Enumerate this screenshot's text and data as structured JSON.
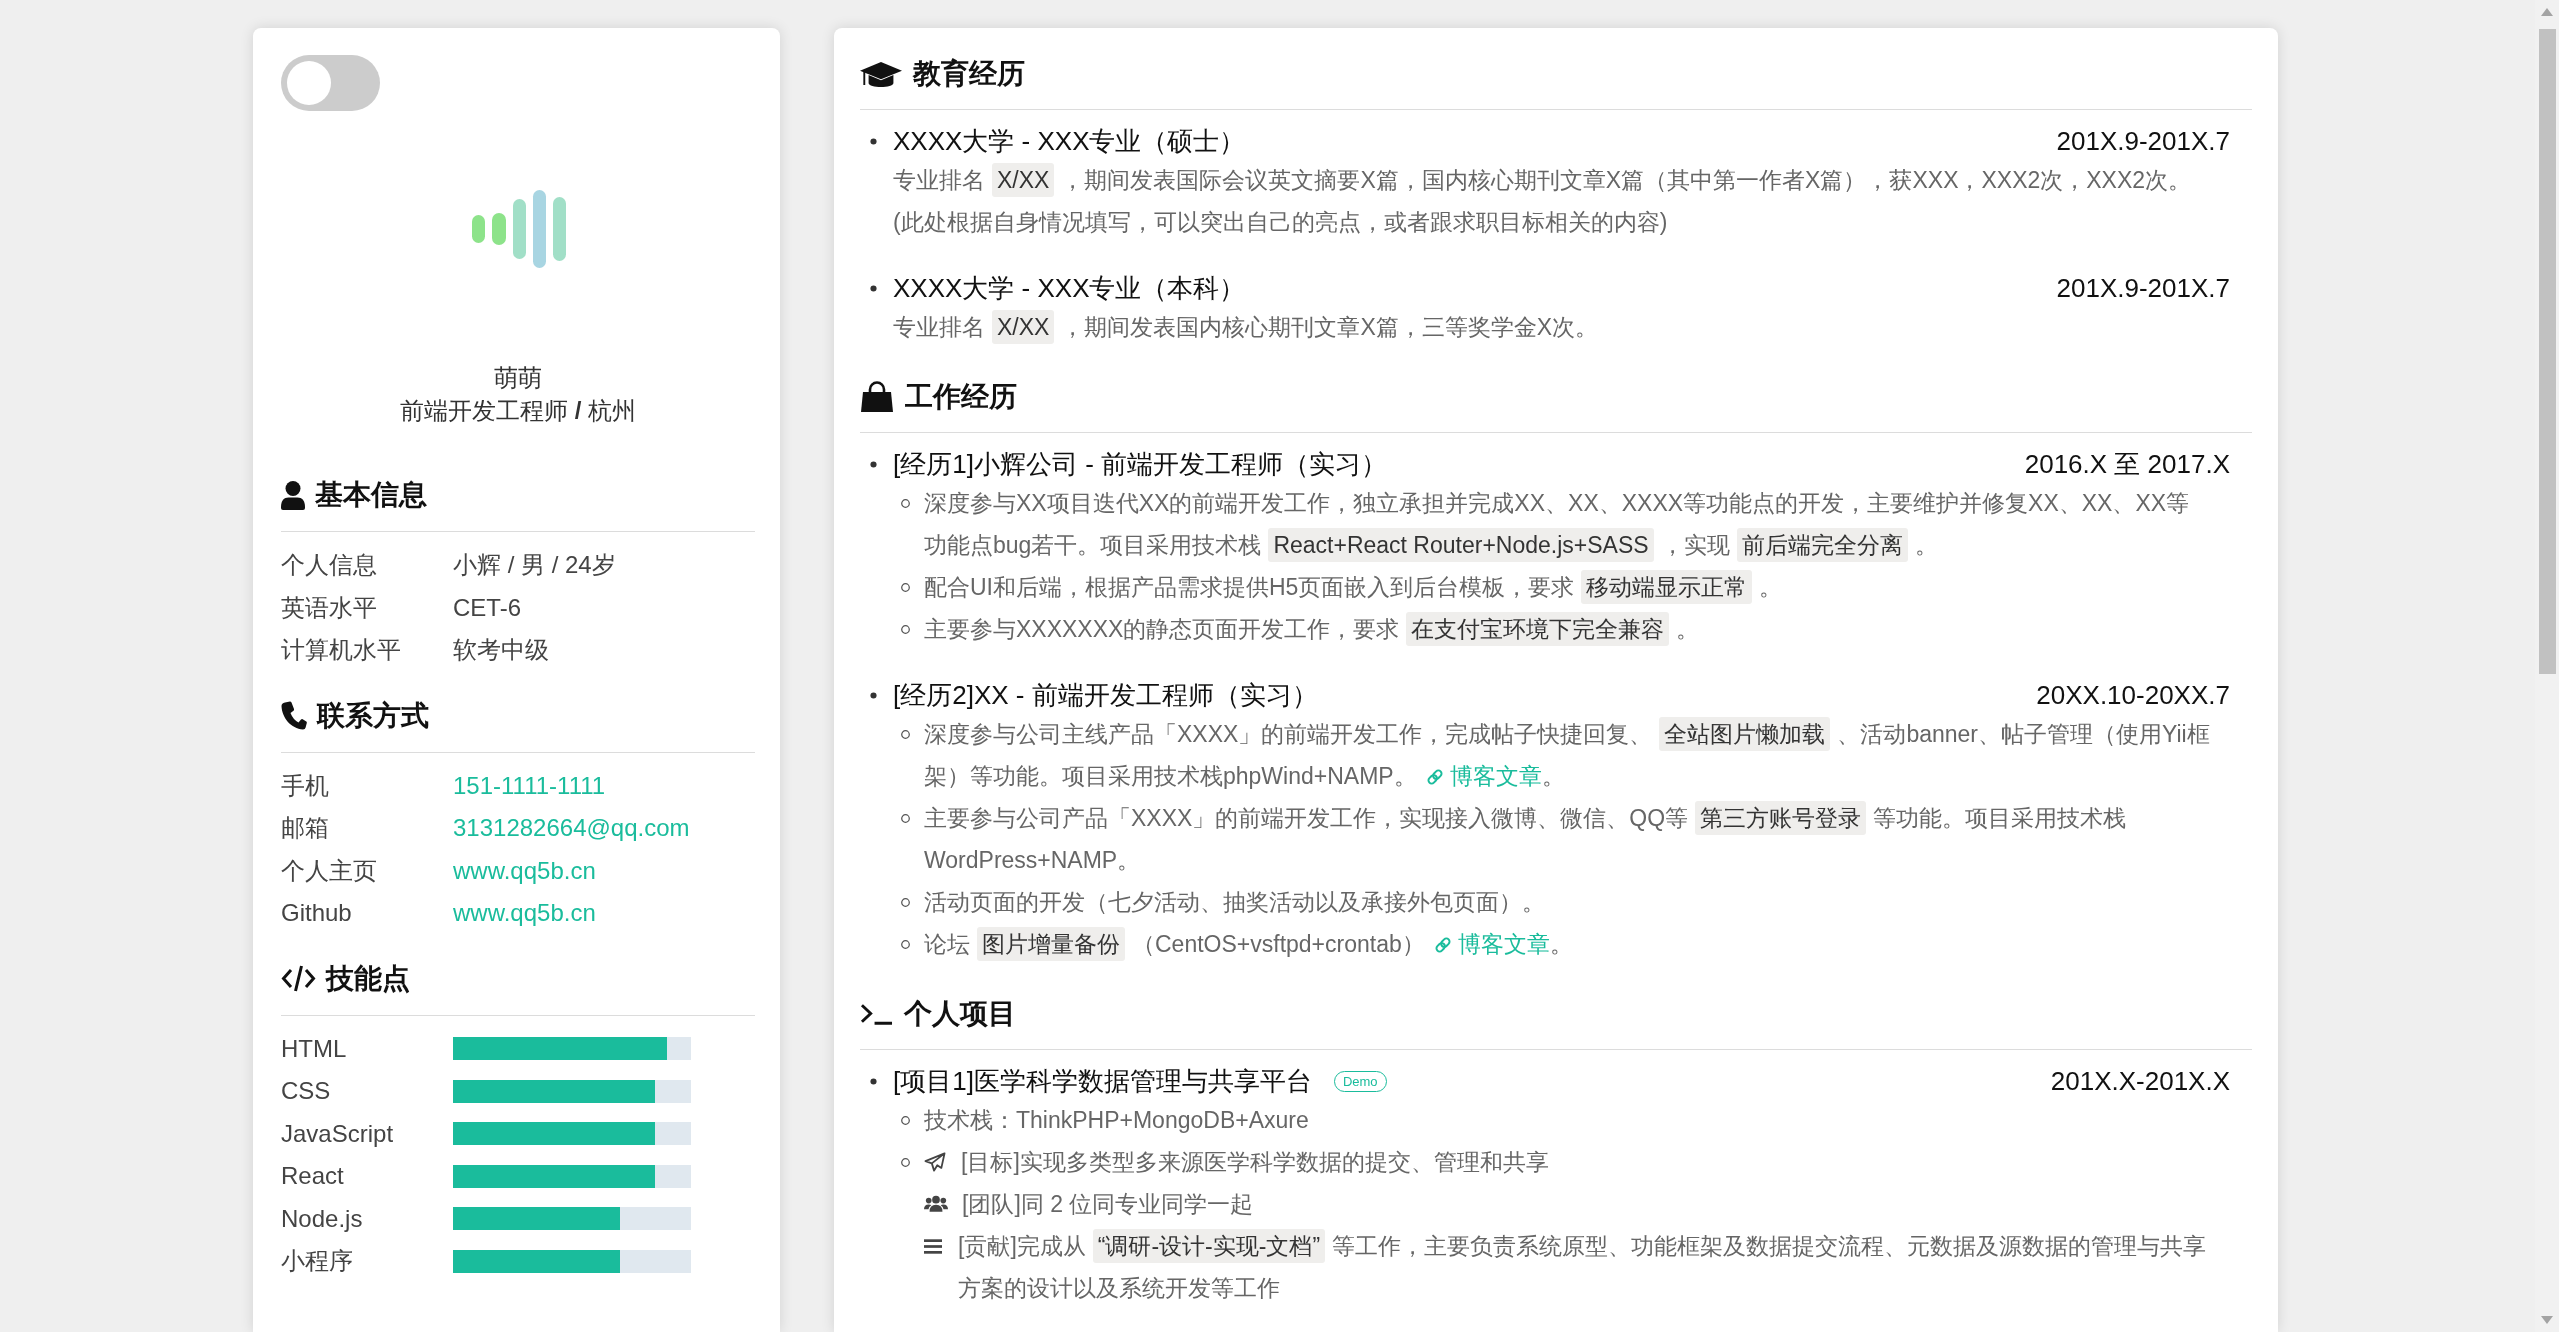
{
  "toggle": {
    "on": false
  },
  "profile": {
    "name": "萌萌",
    "role": "前端开发工程师 **/** 杭州"
  },
  "basic_info": {
    "title": "基本信息",
    "rows": [
      {
        "label": "个人信息",
        "value": "小辉 / 男 / 24岁"
      },
      {
        "label": "英语水平",
        "value": "CET-6"
      },
      {
        "label": "计算机水平",
        "value": "软考中级"
      }
    ]
  },
  "contact": {
    "title": "联系方式",
    "rows": [
      {
        "label": "手机",
        "value": "151-1111-1111"
      },
      {
        "label": "邮箱",
        "value": "3131282664@qq.com"
      },
      {
        "label": "个人主页",
        "value": "www.qq5b.cn"
      },
      {
        "label": "Github",
        "value": "www.qq5b.cn"
      }
    ]
  },
  "skills": {
    "title": "技能点",
    "items": [
      {
        "name": "HTML",
        "level": 0.9
      },
      {
        "name": "CSS",
        "level": 0.85
      },
      {
        "name": "JavaScript",
        "level": 0.85
      },
      {
        "name": "React",
        "level": 0.85
      },
      {
        "name": "Node.js",
        "level": 0.7
      },
      {
        "name": "小程序",
        "level": 0.7
      }
    ]
  },
  "education": {
    "title": "教育经历",
    "items": [
      {
        "title": "XXXX大学 - XXX专业（硕士）",
        "date": "201X.9-201X.7",
        "paragraphs": [
          {
            "segments": [
              {
                "kind": "text",
                "text": "专业排名"
              },
              {
                "kind": "code",
                "text": "X/XX"
              },
              {
                "kind": "text",
                "text": "，期间发表国际会议英文摘要X篇，国内核心期刊文章X篇（其中第一作者X篇），获XXX，XXX2次，XXX2次。"
              }
            ]
          },
          {
            "segments": [
              {
                "kind": "text",
                "text": "(此处根据自身情况填写，可以突出自己的亮点，或者跟求职目标相关的内容)"
              }
            ]
          }
        ]
      },
      {
        "title": "XXXX大学 - XXX专业（本科）",
        "date": "201X.9-201X.7",
        "paragraphs": [
          {
            "segments": [
              {
                "kind": "text",
                "text": "专业排名"
              },
              {
                "kind": "code",
                "text": "X/XX"
              },
              {
                "kind": "text",
                "text": "，期间发表国内核心期刊文章X篇，三等奖学金X次。"
              }
            ]
          }
        ]
      }
    ]
  },
  "work": {
    "title": "工作经历",
    "items": [
      {
        "title": "[经历1]小辉公司 - 前端开发工程师（实习）",
        "date": "2016.X 至 2017.X",
        "details": [
          {
            "paragraphs": [
              {
                "segments": [
                  {
                    "kind": "text",
                    "text": "深度参与XX项目迭代XX的前端开发工作，独立承担并完成XX、XX、XXXX等功能点的开发，主要维护并修复XX、XX、XX等功能点bug若干。项目采用技术栈"
                  },
                  {
                    "kind": "code",
                    "text": "React+React Router+Node.js+SASS"
                  },
                  {
                    "kind": "text",
                    "text": "，实现"
                  },
                  {
                    "kind": "code",
                    "text": "前后端完全分离"
                  },
                  {
                    "kind": "text",
                    "text": "。"
                  }
                ]
              }
            ]
          },
          {
            "paragraphs": [
              {
                "segments": [
                  {
                    "kind": "text",
                    "text": "配合UI和后端，根据产品需求提供H5页面嵌入到后台模板，要求"
                  },
                  {
                    "kind": "code",
                    "text": "移动端显示正常"
                  },
                  {
                    "kind": "text",
                    "text": "。"
                  }
                ]
              }
            ]
          },
          {
            "paragraphs": [
              {
                "segments": [
                  {
                    "kind": "text",
                    "text": "主要参与XXXXXXX的静态页面开发工作，要求"
                  },
                  {
                    "kind": "code",
                    "text": "在支付宝环境下完全兼容"
                  },
                  {
                    "kind": "text",
                    "text": "。"
                  }
                ]
              }
            ]
          }
        ]
      },
      {
        "title": "[经历2]XX - 前端开发工程师（实习）",
        "date": "20XX.10-20XX.7",
        "details": [
          {
            "paragraphs": [
              {
                "segments": [
                  {
                    "kind": "text",
                    "text": "深度参与公司主线产品「XXXX」的前端开发工作，完成帖子快捷回复、"
                  },
                  {
                    "kind": "code",
                    "text": "全站图片懒加载"
                  },
                  {
                    "kind": "text",
                    "text": "、活动banner、帖子管理（使用Yii框架）等功能。项目采用技术栈phpWind+NAMP。"
                  },
                  {
                    "kind": "link",
                    "text": "博客文章"
                  },
                  {
                    "kind": "text",
                    "text": "。"
                  }
                ]
              }
            ]
          },
          {
            "paragraphs": [
              {
                "segments": [
                  {
                    "kind": "text",
                    "text": "主要参与公司产品「XXXX」的前端开发工作，实现接入微博、微信、QQ等"
                  },
                  {
                    "kind": "code",
                    "text": "第三方账号登录"
                  },
                  {
                    "kind": "text",
                    "text": "等功能。项目采用技术栈WordPress+NAMP。"
                  }
                ]
              }
            ]
          },
          {
            "paragraphs": [
              {
                "segments": [
                  {
                    "kind": "text",
                    "text": "活动页面的开发（七夕活动、抽奖活动以及承接外包页面）。"
                  }
                ]
              }
            ]
          },
          {
            "paragraphs": [
              {
                "segments": [
                  {
                    "kind": "text",
                    "text": "论坛"
                  },
                  {
                    "kind": "code",
                    "text": "图片增量备份"
                  },
                  {
                    "kind": "text",
                    "text": "（CentOS+vsftpd+crontab）"
                  },
                  {
                    "kind": "link",
                    "text": "博客文章"
                  },
                  {
                    "kind": "text",
                    "text": "。"
                  }
                ]
              }
            ]
          }
        ]
      }
    ]
  },
  "projects": {
    "title": "个人项目",
    "items": [
      {
        "title": "[项目1]医学科学数据管理与共享平台",
        "tag": "Demo",
        "date": "201X.X-201X.X",
        "details": [
          {
            "paragraphs": [
              {
                "segments": [
                  {
                    "kind": "text",
                    "text": "技术栈：ThinkPHP+MongoDB+Axure"
                  }
                ]
              }
            ]
          },
          {
            "paragraphs": [
              {
                "kind": "goal",
                "segments": [
                  {
                    "kind": "text",
                    "text": "[目标]实现多类型多来源医学科学数据的提交、管理和共享"
                  }
                ]
              },
              {
                "kind": "team",
                "segments": [
                  {
                    "kind": "text",
                    "text": "[团队]同 2 位同专业同学一起"
                  }
                ]
              },
              {
                "kind": "contribution",
                "segments": [
                  {
                    "kind": "text",
                    "text": "[贡献]完成从"
                  },
                  {
                    "kind": "code",
                    "text": "“调研-设计-实现-文档”"
                  },
                  {
                    "kind": "text",
                    "text": "等工作，主要负责系统原型、功能框架及数据提交流程、元数据及源数据的管理与共享方案的设计以及系统开发等工作"
                  }
                ]
              }
            ]
          }
        ]
      }
    ]
  }
}
